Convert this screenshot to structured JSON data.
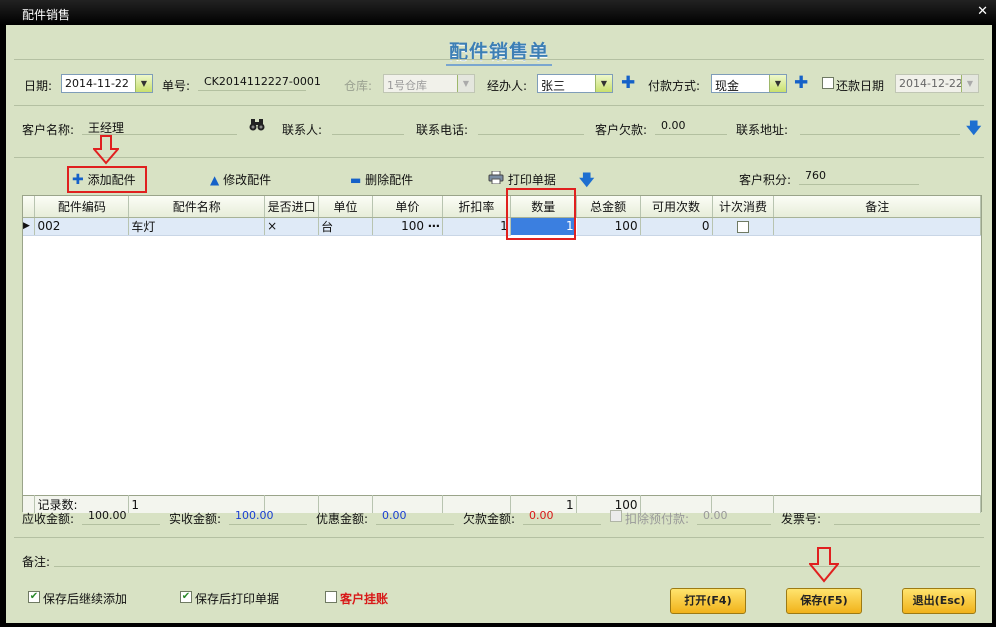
{
  "window": {
    "title": "配件销售"
  },
  "header": {
    "title": "配件销售单"
  },
  "row1": {
    "date_label": "日期:",
    "date_value": "2014-11-22",
    "order_label": "单号:",
    "order_value": "CK2014112227-0001",
    "warehouse_label": "仓库:",
    "warehouse_value": "1号仓库",
    "handler_label": "经办人:",
    "handler_value": "张三",
    "payment_label": "付款方式:",
    "payment_value": "现金",
    "repay_label": "还款日期",
    "repay_value": "2014-12-22"
  },
  "row2": {
    "customer_label": "客户名称:",
    "customer_value": "王经理",
    "contact_label": "联系人:",
    "contact_value": "",
    "phone_label": "联系电话:",
    "phone_value": "",
    "debt_label": "客户欠款:",
    "debt_value": "0.00",
    "address_label": "联系地址:",
    "address_value": ""
  },
  "toolbar": {
    "add": "添加配件",
    "edit": "修改配件",
    "delete": "删除配件",
    "print": "打印单据",
    "points_label": "客户积分:",
    "points_value": "760"
  },
  "grid": {
    "columns": [
      "配件编码",
      "配件名称",
      "是否进口",
      "单位",
      "单价",
      "折扣率",
      "数量",
      "总金额",
      "可用次数",
      "计次消费",
      "备注"
    ],
    "rows": [
      {
        "code": "002",
        "name": "车灯",
        "imported": "×",
        "unit": "台",
        "price": "100",
        "discount": "1",
        "qty": "1",
        "total": "100",
        "uses": "0",
        "remark": ""
      }
    ],
    "footer": {
      "label": "记录数:",
      "count": "1",
      "qty": "1",
      "total": "100"
    }
  },
  "summary": {
    "receivable_label": "应收金额:",
    "receivable_value": "100.00",
    "actual_label": "实收金额:",
    "actual_value": "100.00",
    "discount_label": "优惠金额:",
    "discount_value": "0.00",
    "owed_label": "欠款金额:",
    "owed_value": "0.00",
    "prepay_label": "扣除预付款:",
    "prepay_value": "0.00",
    "invoice_label": "发票号:",
    "invoice_value": ""
  },
  "notes": {
    "label": "备注:",
    "value": ""
  },
  "options": {
    "continue_label": "保存后继续添加",
    "print_label": "保存后打印单据",
    "hold_label": "客户挂账"
  },
  "buttons": {
    "open": "打开(F4)",
    "save": "保存(F5)",
    "exit": "退出(Esc)"
  },
  "colors": {
    "accent_red": "#e0201f",
    "title_blue": "#3d7fb5",
    "actual_blue": "#1a3fd0",
    "owed_red": "#d81818",
    "hold_red": "#d81818"
  }
}
